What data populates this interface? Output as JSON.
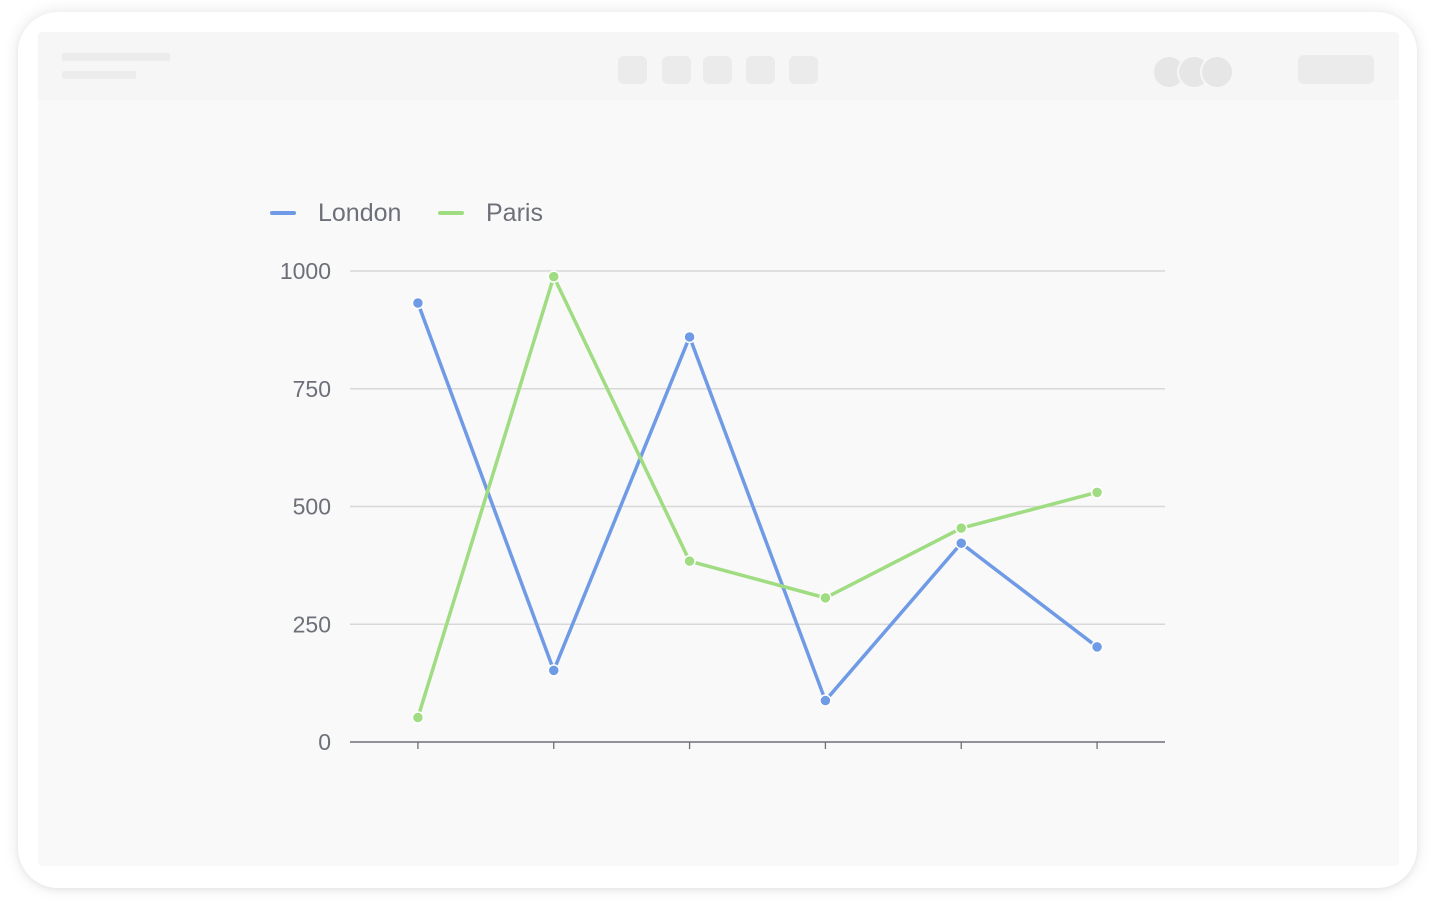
{
  "colors": {
    "london": "#6f9ae6",
    "paris": "#9fdc82",
    "grid": "#d8d8d8",
    "axis": "#6e7079",
    "text": "#6e7079"
  },
  "toolbar": {
    "buttons": [
      "toolbar-button",
      "toolbar-button",
      "toolbar-button",
      "toolbar-button",
      "toolbar-button"
    ],
    "avatars": [
      "avatar",
      "avatar",
      "avatar"
    ]
  },
  "chart_data": {
    "type": "line",
    "title": "",
    "xlabel": "",
    "ylabel": "",
    "categories": [
      "",
      "",
      "",
      "",
      "",
      ""
    ],
    "ylim": [
      0,
      1000
    ],
    "yticks": [
      "0",
      "250",
      "500",
      "750",
      "1000"
    ],
    "grid": true,
    "legend_position": "top-left",
    "series": [
      {
        "name": "London",
        "values": [
          932,
          152,
          860,
          88,
          422,
          202
        ]
      },
      {
        "name": "Paris",
        "values": [
          52,
          988,
          384,
          306,
          454,
          530
        ]
      }
    ]
  }
}
